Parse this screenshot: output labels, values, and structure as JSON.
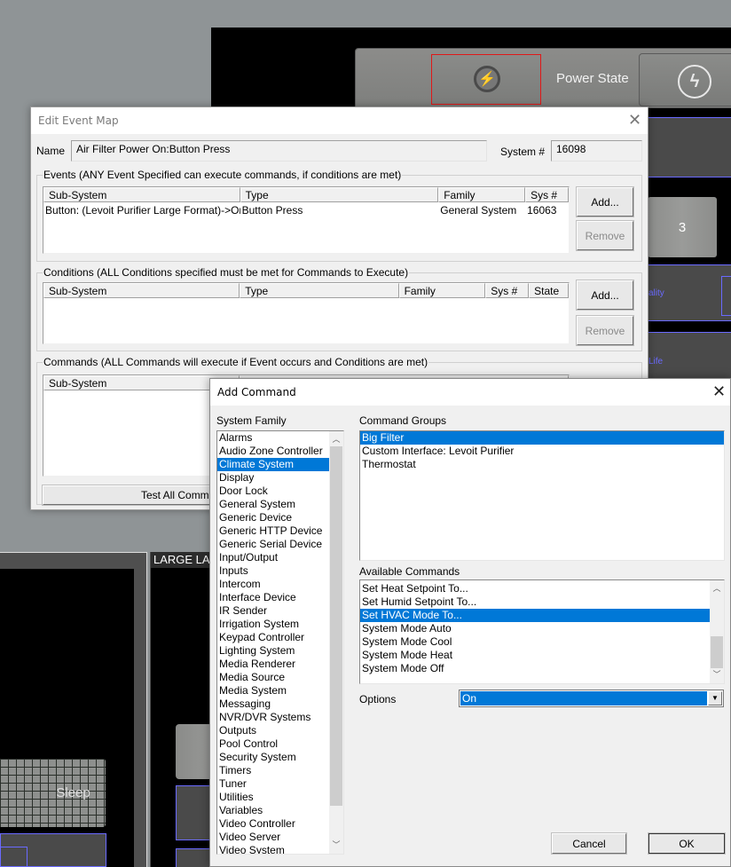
{
  "background_app": {
    "power_label": "Power State",
    "power_icon": "lightning-bolt-icon",
    "button_3_label": "3",
    "partial_label_quality": "ality",
    "partial_label_life": "Life",
    "sleep_label": "Sleep",
    "panel_header": "LARGE LA",
    "accent_color": "#6a6aff",
    "selection_outline_color": "#e01818",
    "bolt_color": "#f4b400"
  },
  "edit_event_map": {
    "title": "Edit Event Map",
    "name_label": "Name",
    "name_value": "Air Filter Power On:Button Press",
    "system_num_label": "System #",
    "system_num_value": "16098",
    "events": {
      "legend": "Events (ANY Event Specified can execute commands, if conditions are met)",
      "columns": [
        "Sub-System",
        "Type",
        "Family",
        "Sys #"
      ],
      "rows": [
        [
          "Button: (Levoit Purifier Large Format)->On",
          "Button Press",
          "General System",
          "16063"
        ]
      ],
      "add_label": "Add...",
      "remove_label": "Remove"
    },
    "conditions": {
      "legend": "Conditions (ALL Conditions specified must be met for Commands to Execute)",
      "columns": [
        "Sub-System",
        "Type",
        "Family",
        "Sys #",
        "State"
      ],
      "rows": [],
      "add_label": "Add...",
      "remove_label": "Remove"
    },
    "commands": {
      "legend": "Commands (ALL Commands will execute if Event occurs and Conditions are met)",
      "columns": [
        "Sub-System"
      ],
      "rows": [],
      "test_all_label": "Test All Comman"
    }
  },
  "add_command": {
    "title": "Add Command",
    "system_family_label": "System Family",
    "system_family_items": [
      "Alarms",
      "Audio Zone Controller",
      "Climate System",
      "Display",
      "Door Lock",
      "General System",
      "Generic Device",
      "Generic HTTP Device",
      "Generic Serial Device",
      "Input/Output",
      "Inputs",
      "Intercom",
      "Interface Device",
      "IR Sender",
      "Irrigation System",
      "Keypad Controller",
      "Lighting System",
      "Media Renderer",
      "Media Source",
      "Media System",
      "Messaging",
      "NVR/DVR Systems",
      "Outputs",
      "Pool Control",
      "Security System",
      "Timers",
      "Tuner",
      "Utilities",
      "Variables",
      "Video Controller",
      "Video Server",
      "Video System"
    ],
    "system_family_selected": "Climate System",
    "command_groups_label": "Command Groups",
    "command_groups_items": [
      "Big Filter",
      "Custom Interface: Levoit Purifier",
      "Thermostat"
    ],
    "command_groups_selected": "Big Filter",
    "available_commands_label": "Available Commands",
    "available_commands_items": [
      "Set Heat Setpoint To...",
      "Set Humid Setpoint To...",
      "Set HVAC Mode To...",
      "System Mode Auto",
      "System Mode Cool",
      "System Mode Heat",
      "System Mode Off"
    ],
    "available_commands_selected": "Set HVAC Mode To...",
    "options_label": "Options",
    "options_value": "On",
    "cancel_label": "Cancel",
    "ok_label": "OK",
    "selection_color": "#0078d7"
  }
}
